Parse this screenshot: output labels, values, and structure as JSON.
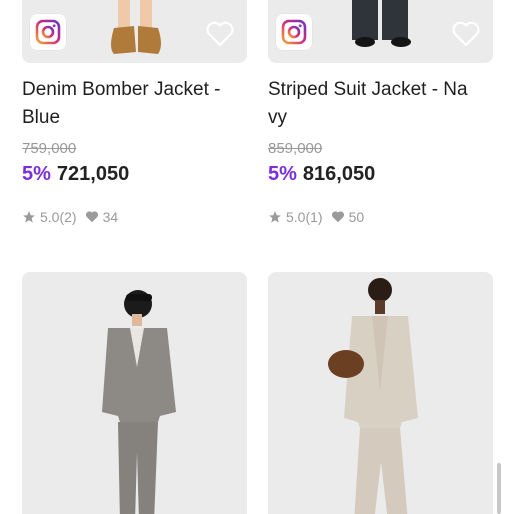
{
  "products": [
    {
      "title": "Denim Bomber Jacket - Blue",
      "original_price": "759,000",
      "discount": "5%",
      "price": "721,050",
      "rating": "5.0(2)",
      "likes": "34"
    },
    {
      "title": "Striped Suit Jacket - Navy",
      "original_price": "859,000",
      "discount": "5%",
      "price": "816,050",
      "rating": "5.0(1)",
      "likes": "50"
    }
  ],
  "icons": {
    "instagram": "instagram-icon",
    "favorite": "heart-outline-icon",
    "rating": "star-icon",
    "likes": "heart-icon"
  },
  "colors": {
    "discount": "#7b2fd8",
    "thumb_bg": "#ebebeb",
    "meta": "#9a9a9a"
  }
}
